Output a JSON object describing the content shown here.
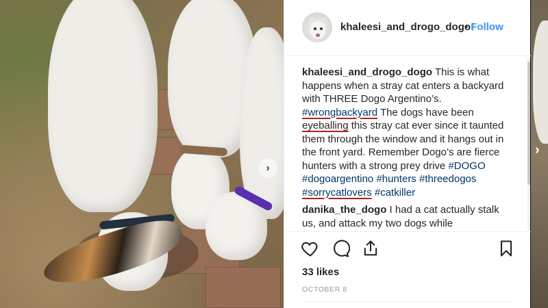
{
  "post": {
    "username": "khaleesi_and_drogo_dogo",
    "separator": "•",
    "follow_label": "Follow",
    "likes": "33 likes",
    "date": "OCTOBER 8"
  },
  "caption": {
    "author": "khaleesi_and_drogo_dogo",
    "text_1": " This is what happens when a stray cat enters a backyard with THREE Dogo Argentino’s. ",
    "tag_wrongbackyard": "#wrongbackyard",
    "text_2": " The dogs have been ",
    "eyeballing": "eyeballing",
    "text_3": " this stray cat ever since it taunted them through the window and it hangs out in the front yard. Remember Dogo’s are fierce hunters with a strong prey drive ",
    "tag_dogo": "#DOGO",
    "tag_dogoargentino": "#dogoargentino",
    "tag_hunters": "#hunters",
    "tag_threedogs": "#threedogos",
    "tag_sorrycatlovers": "#sorrycatlovers",
    "tag_catkiller": "#catkiller"
  },
  "comment": {
    "author": "danika_the_dogo",
    "text": " I had a cat actually stalk us, and attack my two dogs while"
  },
  "icons": {
    "like": "heart-icon",
    "comment": "comment-bubble-icon",
    "share": "share-icon",
    "save": "bookmark-icon",
    "photo_next": "chevron-right-icon",
    "carousel_next": "chevron-right-icon"
  },
  "colors": {
    "link": "#003569",
    "follow": "#3897f0",
    "annotation_underline": "#b21f1f"
  }
}
